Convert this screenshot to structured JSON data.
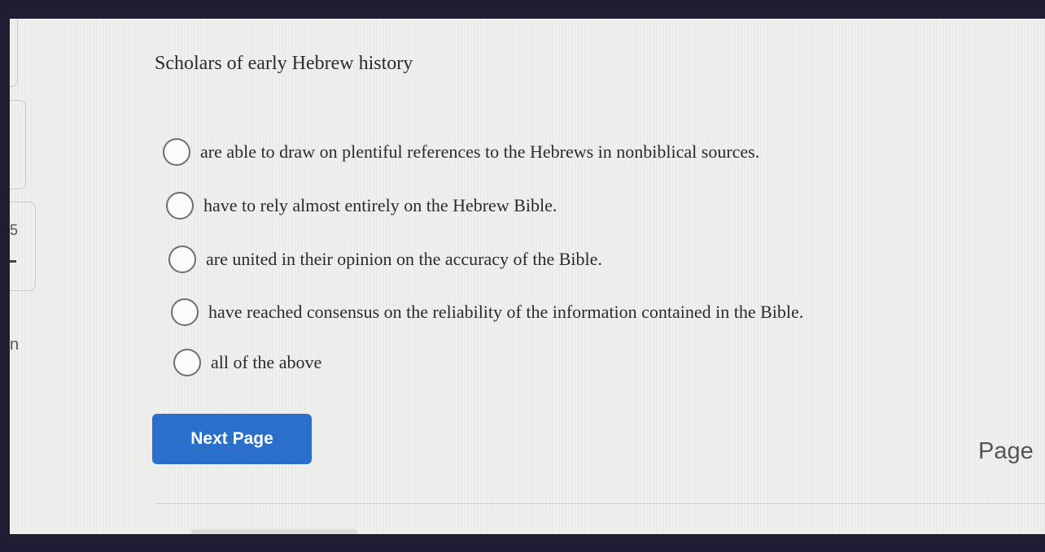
{
  "edge_fragments": {
    "five": "5",
    "n": "n"
  },
  "question": {
    "text": "Scholars of early Hebrew history"
  },
  "options": [
    {
      "label": "are able to draw on plentiful references to the Hebrews in nonbiblical sources.",
      "selected": false
    },
    {
      "label": "have to rely almost entirely on the Hebrew Bible.",
      "selected": false
    },
    {
      "label": "are united in their opinion on the accuracy of the Bible.",
      "selected": false
    },
    {
      "label": "have reached consensus on the reliability of the information contained in the Bible.",
      "selected": false
    },
    {
      "label": "all of the above",
      "selected": false
    }
  ],
  "next_button": {
    "label": "Next Page"
  },
  "page_label": "Page",
  "colors": {
    "accent": "#2a6fc9",
    "bezel": "#1f1d33"
  }
}
